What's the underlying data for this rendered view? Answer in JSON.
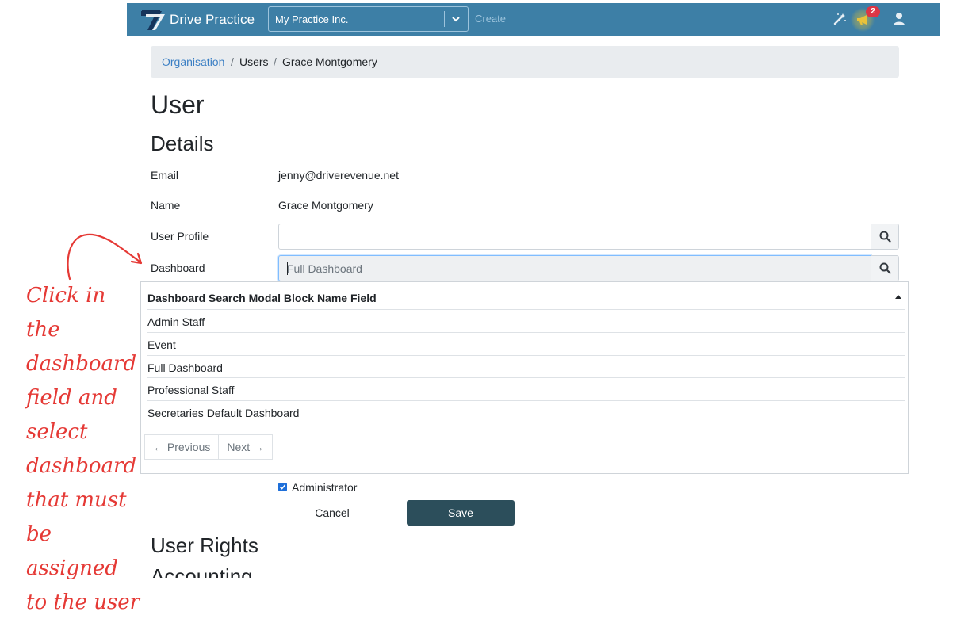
{
  "navbar": {
    "brand": "Drive Practice",
    "org_select": "My Practice Inc.",
    "create": "Create",
    "notification_count": "2",
    "icons": [
      "magic-wand-icon",
      "megaphone-icon",
      "user-icon"
    ]
  },
  "breadcrumb": {
    "items": [
      "Organisation",
      "Users",
      "Grace Montgomery"
    ],
    "separator": "/"
  },
  "page": {
    "title": "User",
    "section": "Details"
  },
  "details": {
    "email_label": "Email",
    "email_value": "jenny@driverevenue.net",
    "name_label": "Name",
    "name_value": "Grace Montgomery",
    "user_profile_label": "User Profile",
    "user_profile_value": "",
    "dashboard_label": "Dashboard",
    "dashboard_placeholder": "Full Dashboard"
  },
  "dropdown": {
    "header": "Dashboard Search Modal Block Name Field",
    "items": [
      "Admin Staff",
      "Event",
      "Full Dashboard",
      "Professional Staff",
      "Secretaries Default Dashboard"
    ],
    "previous": "← Previous",
    "next": "Next →"
  },
  "form": {
    "administrator_label": "Administrator",
    "administrator_checked": true,
    "cancel": "Cancel",
    "save": "Save"
  },
  "sections": {
    "user_rights": "User Rights",
    "accounting": "Accounting"
  },
  "annotation": {
    "text": "Click in the dashboard field and select dashboard that must be assigned to the user",
    "color": "#e53935"
  },
  "colors": {
    "navbar": "#3d7fa6",
    "save_button": "#2c4e5b",
    "link": "#3b7fc4",
    "badge": "#dc3545"
  }
}
